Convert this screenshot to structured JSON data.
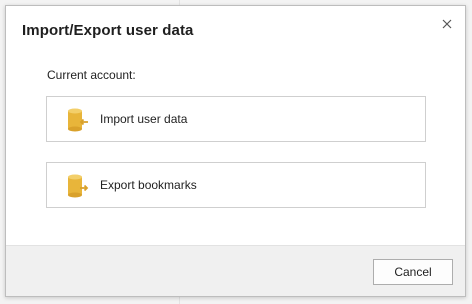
{
  "dialog": {
    "title": "Import/Export user data",
    "close_icon": "close-icon",
    "section_label": "Current account:",
    "options": [
      {
        "label": "Import user data",
        "icon": "database-import-icon"
      },
      {
        "label": "Export bookmarks",
        "icon": "database-export-icon"
      }
    ],
    "cancel_label": "Cancel"
  },
  "colors": {
    "icon_accent": "#e8b53a",
    "border": "#cfcfcf",
    "footer_bg": "#f0f0f0"
  }
}
